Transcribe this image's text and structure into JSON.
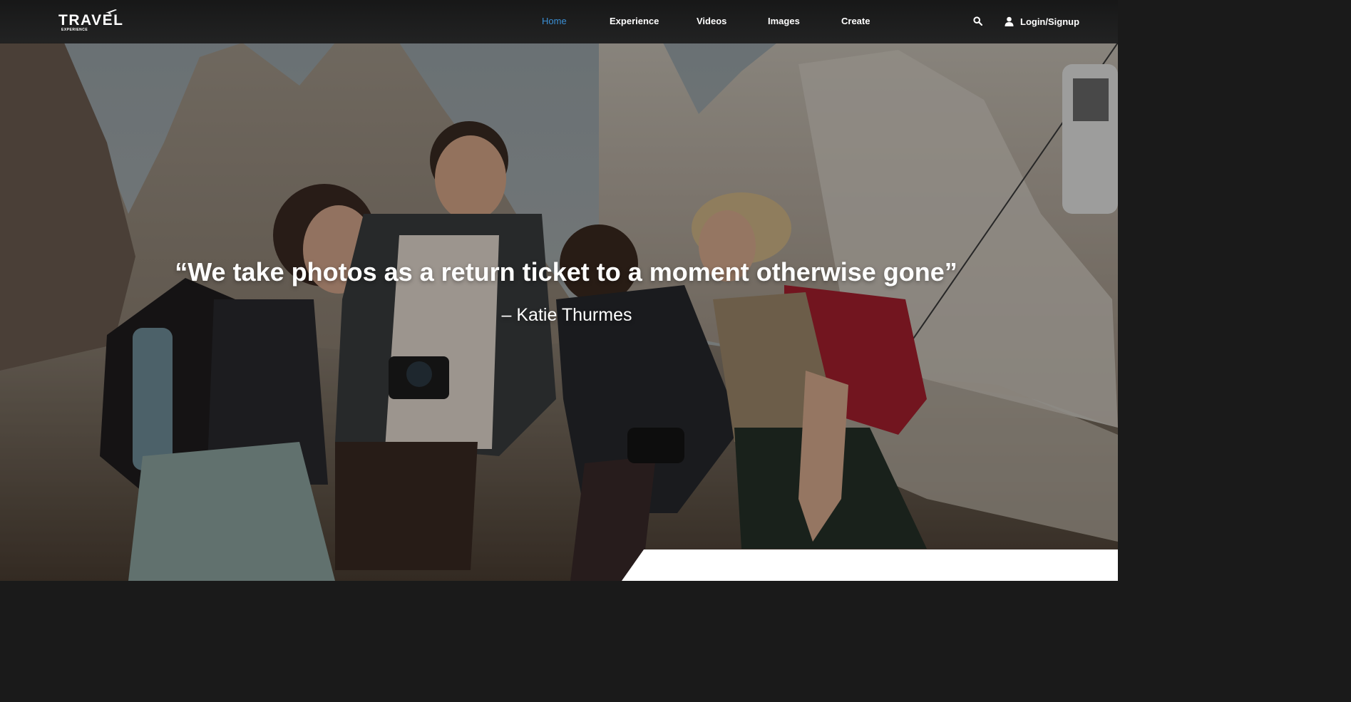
{
  "brand": {
    "name": "TRAVEL",
    "tagline": "EXPERIENCE"
  },
  "nav": {
    "items": [
      {
        "label": "Home",
        "active": true
      },
      {
        "label": "Experience",
        "active": false
      },
      {
        "label": "Videos",
        "active": false
      },
      {
        "label": "Images",
        "active": false
      },
      {
        "label": "Create",
        "active": false
      }
    ],
    "search_icon": "search-icon",
    "user_icon": "user-icon",
    "login_label": "Login/Signup"
  },
  "hero": {
    "quote": "“We take photos as a return ticket to a moment otherwise gone”",
    "author": "– Katie Thurmes"
  },
  "colors": {
    "navbar_bg": "#1c1c1c",
    "active_link": "#3b8fd4",
    "text": "#ffffff"
  }
}
